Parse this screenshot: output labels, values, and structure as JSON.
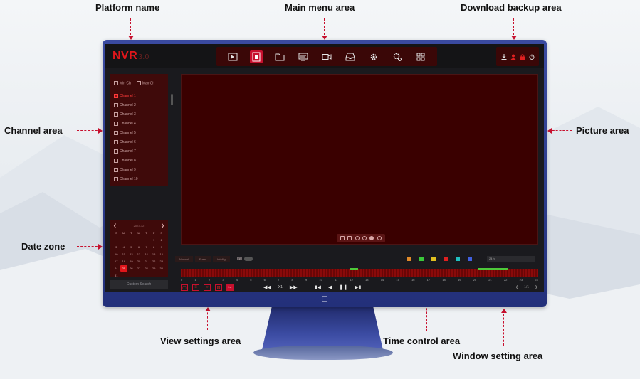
{
  "annotations": {
    "platform_name": "Platform name",
    "main_menu": "Main menu area",
    "download_backup": "Download backup area",
    "channel_area": "Channel area",
    "picture_area": "Picture area",
    "date_zone": "Date zone",
    "view_settings": "View settings area",
    "time_control": "Time control area",
    "window_setting": "Window setting area"
  },
  "app": {
    "brand": "NVR",
    "version": "3.0"
  },
  "main_menu_items": [
    {
      "icon": "play-icon"
    },
    {
      "icon": "playback-icon",
      "active": true
    },
    {
      "icon": "folder-icon"
    },
    {
      "icon": "monitor-icon"
    },
    {
      "icon": "camera-icon"
    },
    {
      "icon": "tray-icon"
    },
    {
      "icon": "gear-icon"
    },
    {
      "icon": "advanced-gear-icon"
    },
    {
      "icon": "grid-icon"
    }
  ],
  "backup_items": [
    {
      "icon": "download-icon"
    },
    {
      "icon": "user-icon"
    },
    {
      "icon": "lock-icon"
    },
    {
      "icon": "power-icon"
    }
  ],
  "channel_panel": {
    "min_label": "Min Ch",
    "max_label": "Max Ch",
    "channels": [
      "Channel 1",
      "Channel 2",
      "Channel 3",
      "Channel 4",
      "Channel 5",
      "Channel 6",
      "Channel 7",
      "Channel 8",
      "Channel 9",
      "Channel 10"
    ],
    "selected_index": 0
  },
  "calendar": {
    "month_label": "2023-12",
    "weekdays": [
      "S",
      "M",
      "T",
      "W",
      "T",
      "F",
      "S"
    ],
    "days": [
      "",
      "",
      "",
      "",
      "",
      "1",
      "2",
      "3",
      "4",
      "5",
      "6",
      "7",
      "8",
      "9",
      "10",
      "11",
      "12",
      "13",
      "14",
      "15",
      "16",
      "17",
      "18",
      "19",
      "20",
      "21",
      "22",
      "23",
      "24",
      "25",
      "26",
      "27",
      "28",
      "29",
      "30",
      "31",
      "",
      "",
      "",
      "",
      "",
      ""
    ],
    "today": "25",
    "custom_search": "Custom Search"
  },
  "controls": {
    "tabs": [
      "Normal",
      "Event",
      "Intellig"
    ],
    "tag_label": "Tag",
    "legend_colors": [
      "#e08a2a",
      "#3ac83a",
      "#e0c020",
      "#e02020",
      "#20c0c0",
      "#4060e0"
    ],
    "zoom_label": "24 h",
    "speed": "X1",
    "page": "1/1"
  },
  "timeline": {
    "ticks": [
      "0",
      "1",
      "2",
      "3",
      "4",
      "5",
      "6",
      "7",
      "8",
      "9",
      "10",
      "11",
      "12",
      "13",
      "14",
      "15",
      "16",
      "17",
      "18",
      "19",
      "20",
      "21",
      "22",
      "23",
      "24"
    ],
    "green_segments": [
      [
        11.4,
        11.9
      ],
      [
        20.0,
        22.0
      ]
    ]
  }
}
